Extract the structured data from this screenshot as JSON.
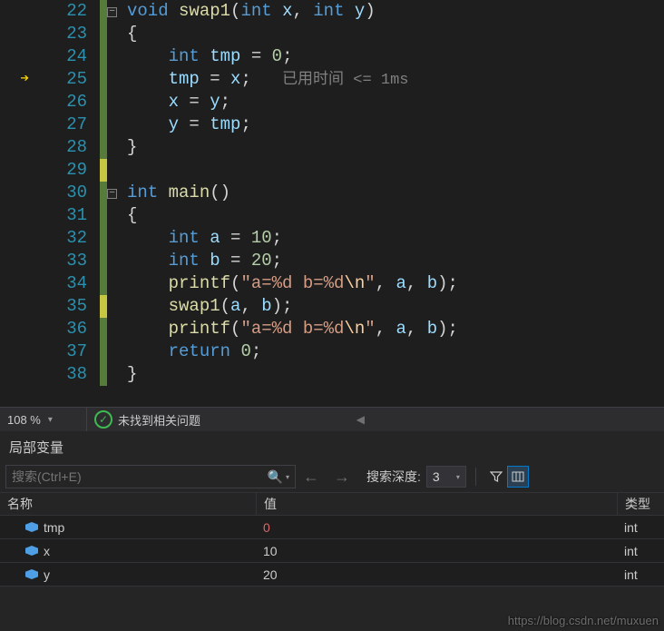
{
  "editor": {
    "lines": [
      {
        "num": 22,
        "change": "green",
        "fold": "minus",
        "arrow": false
      },
      {
        "num": 23,
        "change": "green",
        "fold": "",
        "arrow": false
      },
      {
        "num": 24,
        "change": "green",
        "fold": "",
        "arrow": false
      },
      {
        "num": 25,
        "change": "green",
        "fold": "",
        "arrow": true
      },
      {
        "num": 26,
        "change": "green",
        "fold": "",
        "arrow": false
      },
      {
        "num": 27,
        "change": "green",
        "fold": "",
        "arrow": false
      },
      {
        "num": 28,
        "change": "green",
        "fold": "",
        "arrow": false
      },
      {
        "num": 29,
        "change": "yellow",
        "fold": "",
        "arrow": false
      },
      {
        "num": 30,
        "change": "green",
        "fold": "minus",
        "arrow": false
      },
      {
        "num": 31,
        "change": "green",
        "fold": "",
        "arrow": false
      },
      {
        "num": 32,
        "change": "green",
        "fold": "",
        "arrow": false
      },
      {
        "num": 33,
        "change": "green",
        "fold": "",
        "arrow": false
      },
      {
        "num": 34,
        "change": "green",
        "fold": "",
        "arrow": false
      },
      {
        "num": 35,
        "change": "yellow",
        "fold": "",
        "arrow": false
      },
      {
        "num": 36,
        "change": "green",
        "fold": "",
        "arrow": false
      },
      {
        "num": 37,
        "change": "green",
        "fold": "",
        "arrow": false
      },
      {
        "num": 38,
        "change": "green",
        "fold": "",
        "arrow": false
      }
    ],
    "code_tokens": {
      "l22": [
        [
          "kw",
          "void"
        ],
        [
          "pln",
          " "
        ],
        [
          "id",
          "swap1"
        ],
        [
          "pln",
          "("
        ],
        [
          "kw",
          "int"
        ],
        [
          "pln",
          " "
        ],
        [
          "var",
          "x"
        ],
        [
          "pln",
          ", "
        ],
        [
          "kw",
          "int"
        ],
        [
          "pln",
          " "
        ],
        [
          "var",
          "y"
        ],
        [
          "pln",
          ")"
        ]
      ],
      "l23": [
        [
          "pln",
          "{"
        ]
      ],
      "l24": [
        [
          "pln",
          "    "
        ],
        [
          "kw",
          "int"
        ],
        [
          "pln",
          " "
        ],
        [
          "var",
          "tmp"
        ],
        [
          "pln",
          " = "
        ],
        [
          "num",
          "0"
        ],
        [
          "pln",
          ";"
        ]
      ],
      "l25": [
        [
          "pln",
          "    "
        ],
        [
          "var",
          "tmp"
        ],
        [
          "pln",
          " = "
        ],
        [
          "var",
          "x"
        ],
        [
          "pln",
          ";   "
        ],
        [
          "hint",
          "已用时间 <= 1ms"
        ]
      ],
      "l26": [
        [
          "pln",
          "    "
        ],
        [
          "var",
          "x"
        ],
        [
          "pln",
          " = "
        ],
        [
          "var",
          "y"
        ],
        [
          "pln",
          ";"
        ]
      ],
      "l27": [
        [
          "pln",
          "    "
        ],
        [
          "var",
          "y"
        ],
        [
          "pln",
          " = "
        ],
        [
          "var",
          "tmp"
        ],
        [
          "pln",
          ";"
        ]
      ],
      "l28": [
        [
          "pln",
          "}"
        ]
      ],
      "l29": [],
      "l30": [
        [
          "kw",
          "int"
        ],
        [
          "pln",
          " "
        ],
        [
          "id",
          "main"
        ],
        [
          "pln",
          "()"
        ]
      ],
      "l31": [
        [
          "pln",
          "{"
        ]
      ],
      "l32": [
        [
          "pln",
          "    "
        ],
        [
          "kw",
          "int"
        ],
        [
          "pln",
          " "
        ],
        [
          "var",
          "a"
        ],
        [
          "pln",
          " = "
        ],
        [
          "num",
          "10"
        ],
        [
          "pln",
          ";"
        ]
      ],
      "l33": [
        [
          "pln",
          "    "
        ],
        [
          "kw",
          "int"
        ],
        [
          "pln",
          " "
        ],
        [
          "var",
          "b"
        ],
        [
          "pln",
          " = "
        ],
        [
          "num",
          "20"
        ],
        [
          "pln",
          ";"
        ]
      ],
      "l34": [
        [
          "pln",
          "    "
        ],
        [
          "id",
          "printf"
        ],
        [
          "pln",
          "("
        ],
        [
          "str",
          "\"a=%d b=%d"
        ],
        [
          "esc",
          "\\n"
        ],
        [
          "str",
          "\""
        ],
        [
          "pln",
          ", "
        ],
        [
          "var",
          "a"
        ],
        [
          "pln",
          ", "
        ],
        [
          "var",
          "b"
        ],
        [
          "pln",
          ");"
        ]
      ],
      "l35": [
        [
          "pln",
          "    "
        ],
        [
          "id",
          "swap1"
        ],
        [
          "pln",
          "("
        ],
        [
          "var",
          "a"
        ],
        [
          "pln",
          ", "
        ],
        [
          "var",
          "b"
        ],
        [
          "pln",
          ");"
        ]
      ],
      "l36": [
        [
          "pln",
          "    "
        ],
        [
          "id",
          "printf"
        ],
        [
          "pln",
          "("
        ],
        [
          "str",
          "\"a=%d b=%d"
        ],
        [
          "esc",
          "\\n"
        ],
        [
          "str",
          "\""
        ],
        [
          "pln",
          ", "
        ],
        [
          "var",
          "a"
        ],
        [
          "pln",
          ", "
        ],
        [
          "var",
          "b"
        ],
        [
          "pln",
          ");"
        ]
      ],
      "l37": [
        [
          "pln",
          "    "
        ],
        [
          "kw",
          "return"
        ],
        [
          "pln",
          " "
        ],
        [
          "num",
          "0"
        ],
        [
          "pln",
          ";"
        ]
      ],
      "l38": [
        [
          "pln",
          "}"
        ]
      ]
    }
  },
  "status": {
    "zoom": "108 %",
    "issues_text": "未找到相关问题"
  },
  "locals": {
    "panel_title": "局部变量",
    "search_placeholder": "搜索(Ctrl+E)",
    "depth_label": "搜索深度:",
    "depth_value": "3",
    "columns": {
      "name": "名称",
      "value": "值",
      "type": "类型"
    },
    "rows": [
      {
        "name": "tmp",
        "value": "0",
        "value_changed": true,
        "type": "int"
      },
      {
        "name": "x",
        "value": "10",
        "value_changed": false,
        "type": "int"
      },
      {
        "name": "y",
        "value": "20",
        "value_changed": false,
        "type": "int"
      }
    ]
  },
  "watermark": "https://blog.csdn.net/muxuen"
}
